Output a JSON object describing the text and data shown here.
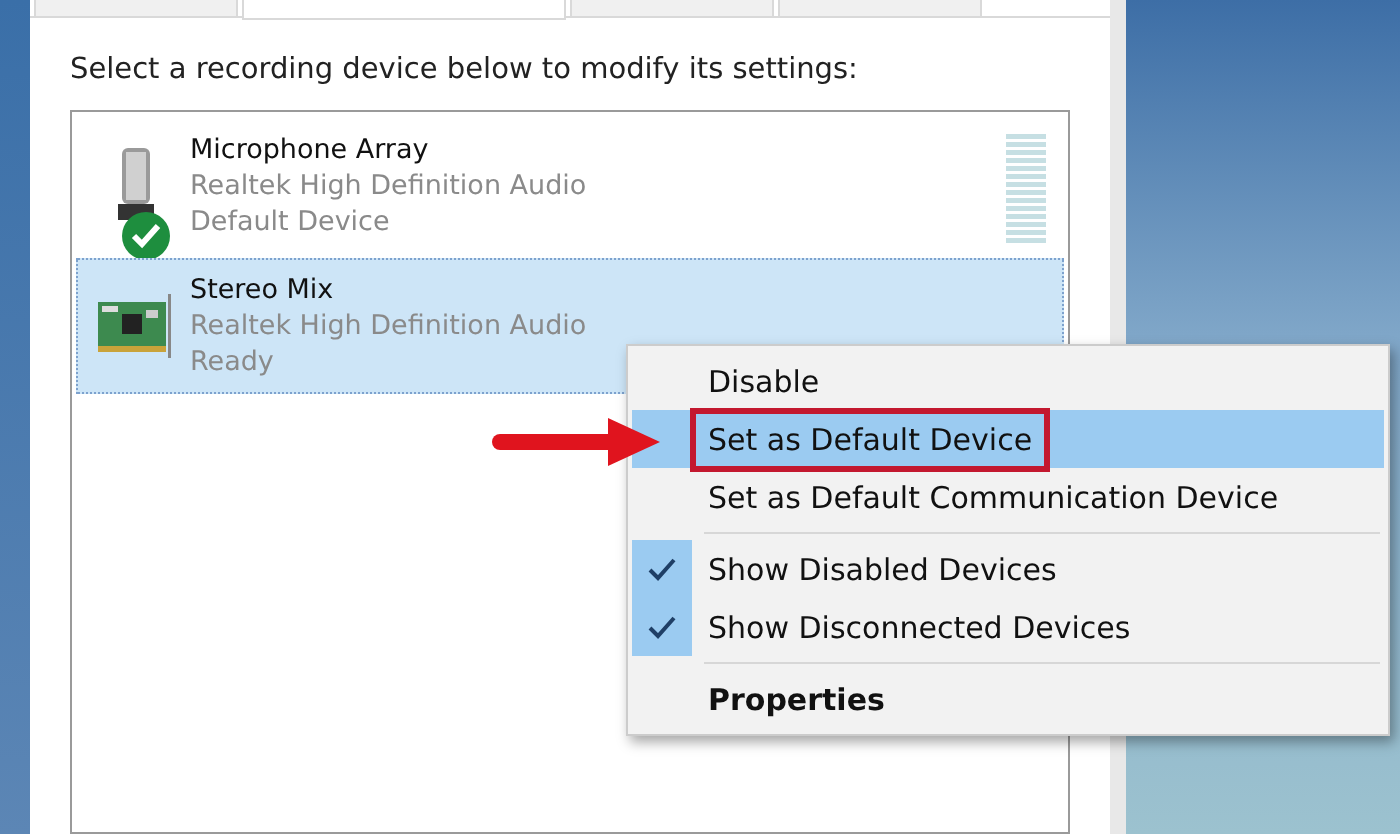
{
  "tabs": [
    {
      "selected": false
    },
    {
      "selected": true
    },
    {
      "selected": false
    },
    {
      "selected": false
    }
  ],
  "instruction": "Select a recording device below to modify its settings:",
  "devices": [
    {
      "kind": "microphone",
      "name": "Microphone Array",
      "driver": "Realtek High Definition Audio",
      "status": "Default Device",
      "is_default": true,
      "meter": true,
      "selected": false
    },
    {
      "kind": "sound-card",
      "name": "Stereo Mix",
      "driver": "Realtek High Definition Audio",
      "status": "Ready",
      "is_default": false,
      "meter": false,
      "selected": true
    }
  ],
  "context_menu": [
    {
      "kind": "item",
      "label": "Disable",
      "selected": false,
      "checked": false,
      "callout": false
    },
    {
      "kind": "item",
      "label": "Set as Default Device",
      "selected": true,
      "checked": false,
      "callout": true
    },
    {
      "kind": "item",
      "label": "Set as Default Communication Device",
      "selected": false,
      "checked": false,
      "callout": false
    },
    {
      "kind": "separator"
    },
    {
      "kind": "item",
      "label": "Show Disabled Devices",
      "selected": false,
      "checked": true,
      "callout": false
    },
    {
      "kind": "item",
      "label": "Show Disconnected Devices",
      "selected": false,
      "checked": true,
      "callout": false
    },
    {
      "kind": "separator"
    },
    {
      "kind": "default",
      "label": "Properties",
      "selected": false,
      "checked": false,
      "callout": false
    }
  ]
}
